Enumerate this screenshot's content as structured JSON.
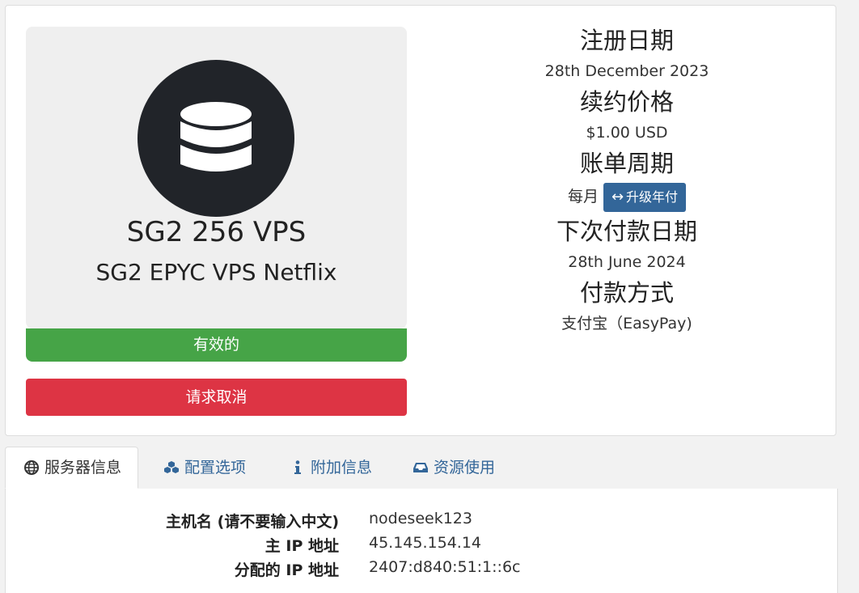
{
  "product": {
    "icon": "database-icon",
    "name": "SG2 256 VPS",
    "group": "SG2 EPYC VPS Netflix",
    "status": "有效的",
    "cancel_label": "请求取消"
  },
  "details": {
    "reg_date_label": "注册日期",
    "reg_date_value": "28th December 2023",
    "renew_price_label": "续约价格",
    "renew_price_value": "$1.00 USD",
    "billing_cycle_label": "账单周期",
    "billing_cycle_value": "每月",
    "upgrade_label": "升级年付",
    "next_due_label": "下次付款日期",
    "next_due_value": "28th June 2024",
    "payment_method_label": "付款方式",
    "payment_method_value": "支付宝（EasyPay)"
  },
  "tabs": [
    {
      "label": "服务器信息",
      "icon": "globe-icon",
      "active": true
    },
    {
      "label": "配置选项",
      "icon": "cubes-icon",
      "active": false
    },
    {
      "label": "附加信息",
      "icon": "info-icon",
      "active": false
    },
    {
      "label": "资源使用",
      "icon": "inbox-icon",
      "active": false
    }
  ],
  "server_info": [
    {
      "label": "主机名 (请不要输入中文)",
      "value": "nodeseek123"
    },
    {
      "label": "主 IP 地址",
      "value": "45.145.154.14"
    },
    {
      "label": "分配的 IP 地址",
      "value": "2407:d840:51:1::6c"
    }
  ],
  "colors": {
    "status_active": "#46a447",
    "cancel": "#dd3444",
    "link": "#336699",
    "icon_circle": "#212429"
  }
}
